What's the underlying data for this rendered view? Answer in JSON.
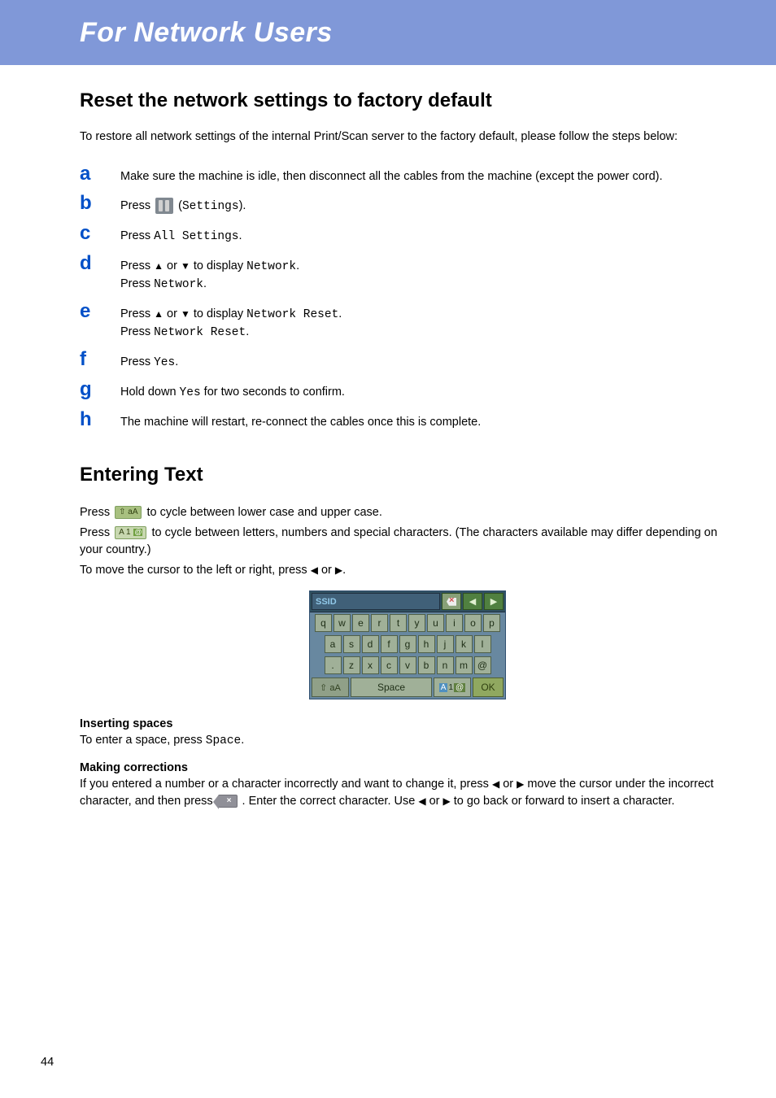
{
  "banner": {
    "title": "For Network Users"
  },
  "section1": {
    "heading": "Reset the network settings to factory default",
    "intro": "To restore all network settings of the internal Print/Scan server to the factory default, please follow the steps below:",
    "steps": {
      "a": {
        "letter": "a",
        "text": "Make sure the machine is idle, then disconnect all the cables from the machine (except the power cord)."
      },
      "b": {
        "letter": "b",
        "press": "Press ",
        "settings_code": "Settings",
        "close": ")."
      },
      "c": {
        "letter": "c",
        "press": "Press ",
        "code": "All Settings",
        "dot": "."
      },
      "d": {
        "letter": "d",
        "l1a": "Press ",
        "l1b": " or ",
        "l1c": " to display ",
        "code1": "Network",
        "dot1": ".",
        "l2a": "Press ",
        "code2": "Network",
        "dot2": "."
      },
      "e": {
        "letter": "e",
        "l1a": "Press ",
        "l1b": " or ",
        "l1c": " to display ",
        "code1": "Network Reset",
        "dot1": ".",
        "l2a": "Press ",
        "code2": "Network Reset",
        "dot2": "."
      },
      "f": {
        "letter": "f",
        "press": "Press ",
        "code": "Yes",
        "dot": "."
      },
      "g": {
        "letter": "g",
        "t1": "Hold down ",
        "code": "Yes",
        "t2": " for two seconds to confirm."
      },
      "h": {
        "letter": "h",
        "text": "The machine will restart, re-connect the cables once this is complete."
      }
    }
  },
  "section2": {
    "heading": "Entering Text",
    "p1a": "Press ",
    "shift_label": "⇧ aA",
    "p1b": " to cycle between lower case and upper case.",
    "p2a": "Press ",
    "mode_label_A": "A",
    "mode_label_1": "1",
    "mode_label_at": "@",
    "p2b": " to cycle between letters, numbers and special characters. (The characters available may differ depending on your country.)",
    "p3a": "To move the cursor to the left or right, press ",
    "p3b": " or ",
    "p3c": "."
  },
  "keyboard": {
    "ssid": "SSID",
    "row1": [
      "q",
      "w",
      "e",
      "r",
      "t",
      "y",
      "u",
      "i",
      "o",
      "p"
    ],
    "row2": [
      "a",
      "s",
      "d",
      "f",
      "g",
      "h",
      "j",
      "k",
      "l"
    ],
    "row3": [
      ".",
      "z",
      "x",
      "c",
      "v",
      "b",
      "n",
      "m",
      "@"
    ],
    "shift": "⇧ aA",
    "space": "Space",
    "mode_A": "A",
    "mode_1": "1",
    "mode_at": "@",
    "ok": "OK"
  },
  "inserting": {
    "head": "Inserting spaces",
    "t1": "To enter a space, press ",
    "code": "Space",
    "dot": "."
  },
  "making": {
    "head": "Making corrections",
    "t1": "If you entered a number or a character incorrectly and want to change it, press ",
    "or": " or ",
    "t2": " move the cursor under the incorrect character, and then press ",
    "bs": "×",
    "t3": " . Enter the correct character. Use ",
    "t4": " to go back or forward to insert a character."
  },
  "page": "44",
  "glyphs": {
    "up": "▲",
    "down": "▼",
    "left": "◀",
    "right": "▶",
    "left_solid": "◀",
    "right_solid": "▶"
  }
}
